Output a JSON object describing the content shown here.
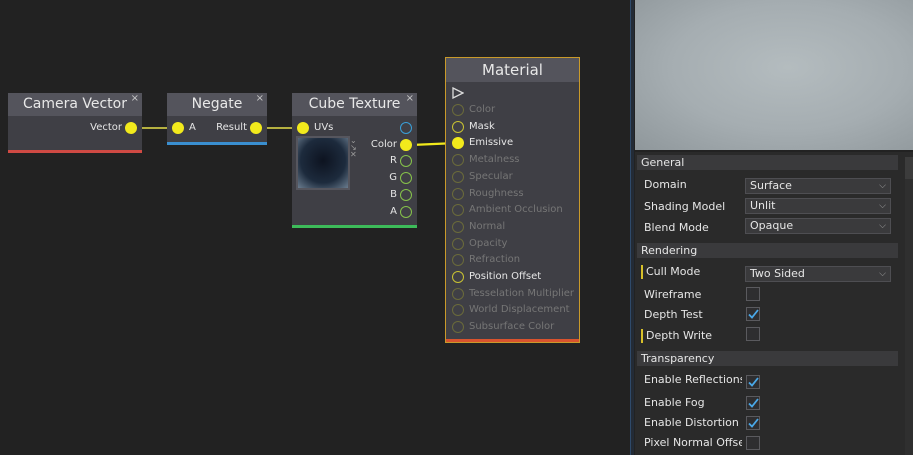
{
  "nodes": {
    "camera_vector": {
      "title": "Camera Vector",
      "close": "×",
      "outputs": [
        "Vector"
      ]
    },
    "negate": {
      "title": "Negate",
      "close": "×",
      "inputs": [
        "A"
      ],
      "outputs": [
        "Result"
      ]
    },
    "cube_texture": {
      "title": "Cube Texture",
      "close": "×",
      "inputs": [
        "UVs"
      ],
      "outputs": [
        "Color",
        "R",
        "G",
        "B",
        "A"
      ]
    },
    "material": {
      "title": "Material",
      "pins": [
        {
          "label": "Color",
          "active": false
        },
        {
          "label": "Mask",
          "active": true
        },
        {
          "label": "Emissive",
          "active": true
        },
        {
          "label": "Metalness",
          "active": false
        },
        {
          "label": "Specular",
          "active": false
        },
        {
          "label": "Roughness",
          "active": false
        },
        {
          "label": "Ambient Occlusion",
          "active": false
        },
        {
          "label": "Normal",
          "active": false
        },
        {
          "label": "Opacity",
          "active": false
        },
        {
          "label": "Refraction",
          "active": false
        },
        {
          "label": "Position Offset",
          "active": true
        },
        {
          "label": "Tesselation Multiplier",
          "active": false
        },
        {
          "label": "World Displacement",
          "active": false
        },
        {
          "label": "Subsurface Color",
          "active": false
        }
      ]
    }
  },
  "properties": {
    "general": {
      "header": "General",
      "domain": {
        "label": "Domain",
        "value": "Surface"
      },
      "shading_model": {
        "label": "Shading Model",
        "value": "Unlit"
      },
      "blend_mode": {
        "label": "Blend Mode",
        "value": "Opaque"
      }
    },
    "rendering": {
      "header": "Rendering",
      "cull_mode": {
        "label": "Cull Mode",
        "value": "Two Sided"
      },
      "wireframe": {
        "label": "Wireframe",
        "checked": false
      },
      "depth_test": {
        "label": "Depth Test",
        "checked": true
      },
      "depth_write": {
        "label": "Depth Write",
        "checked": false
      }
    },
    "transparency": {
      "header": "Transparency",
      "enable_reflections": {
        "label": "Enable Reflections",
        "checked": true
      },
      "enable_fog": {
        "label": "Enable Fog",
        "checked": true
      },
      "enable_distortion": {
        "label": "Enable Distortion",
        "checked": true
      },
      "pixel_normal_offset": {
        "label": "Pixel Normal Offset",
        "checked": false
      }
    }
  },
  "colors": {
    "pin_yellow": "#f2ea1c",
    "camera_bar": "#d04a44",
    "negate_bar": "#3a8fd0",
    "cube_bar": "#3dbb5a",
    "material_bar": "#d9532e",
    "material_border": "#c99a2a",
    "check_blue": "#4aa8e8"
  }
}
